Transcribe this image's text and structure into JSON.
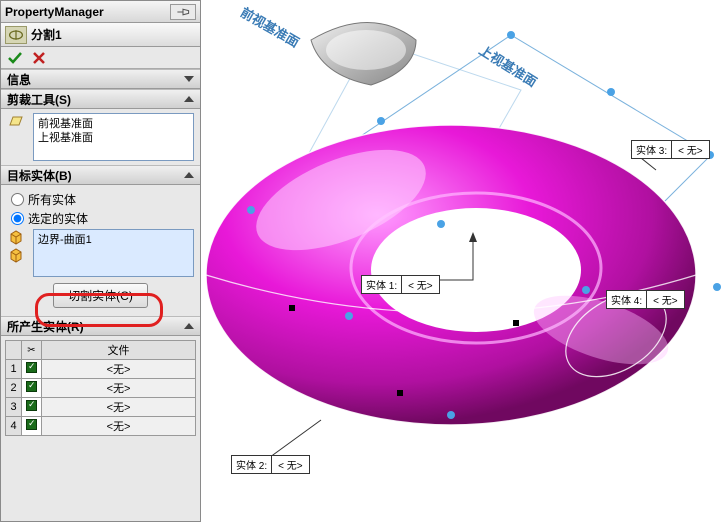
{
  "pm": {
    "title": "PropertyManager",
    "feature": "分割1"
  },
  "sections": {
    "info": "信息",
    "trim": {
      "label": "剪裁工具(S)",
      "items": [
        "前视基准面",
        "上视基准面"
      ]
    },
    "target": {
      "label": "目标实体(B)",
      "radio_all": "所有实体",
      "radio_selected": "选定的实体",
      "selected_item": "边界-曲面1",
      "cut_button": "切割实体(C)"
    },
    "results": {
      "label": "所产生实体(R)",
      "file_header": "文件",
      "rows": [
        "<无>",
        "<无>",
        "<无>",
        "<无>"
      ]
    }
  },
  "planes": {
    "front": "前视基准面",
    "top": "上视基准面"
  },
  "callouts": [
    {
      "label": "实体  1:",
      "value": "< 无>"
    },
    {
      "label": "实体  2:",
      "value": "< 无>"
    },
    {
      "label": "实体  3:",
      "value": "< 无>"
    },
    {
      "label": "实体  4:",
      "value": "< 无>"
    }
  ]
}
